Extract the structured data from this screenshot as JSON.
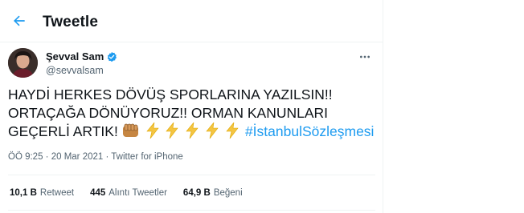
{
  "header": {
    "title": "Tweetle",
    "back_icon": "arrow-left-icon"
  },
  "author": {
    "name": "Şevval Sam",
    "handle": "@sevvalsam",
    "verified": true,
    "verified_color": "#1d9bf0"
  },
  "tweet": {
    "line1": "HAYDİ HERKES DÖVÜŞ SPORLARINA YAZILSIN!!",
    "line2": "ORTAÇAĞA DÖNÜYORUZ!! ORMAN KANUNLARI",
    "line3_text": "GEÇERLİ ARTIK!",
    "emojis": [
      "fist-emoji",
      "lightning-emoji",
      "lightning-emoji",
      "lightning-emoji",
      "lightning-emoji",
      "lightning-emoji"
    ],
    "hashtag": "#İstanbulSözleşmesi",
    "hashtag_color": "#1d9bf0"
  },
  "meta": {
    "time": "ÖÖ 9:25",
    "separator": " · ",
    "date": "20 Mar 2021",
    "source": "Twitter for iPhone"
  },
  "stats": {
    "retweets_count": "10,1 B",
    "retweets_label": "Retweet",
    "quotes_count": "445",
    "quotes_label": "Alıntı Tweetler",
    "likes_count": "64,9 B",
    "likes_label": "Beğeni"
  }
}
